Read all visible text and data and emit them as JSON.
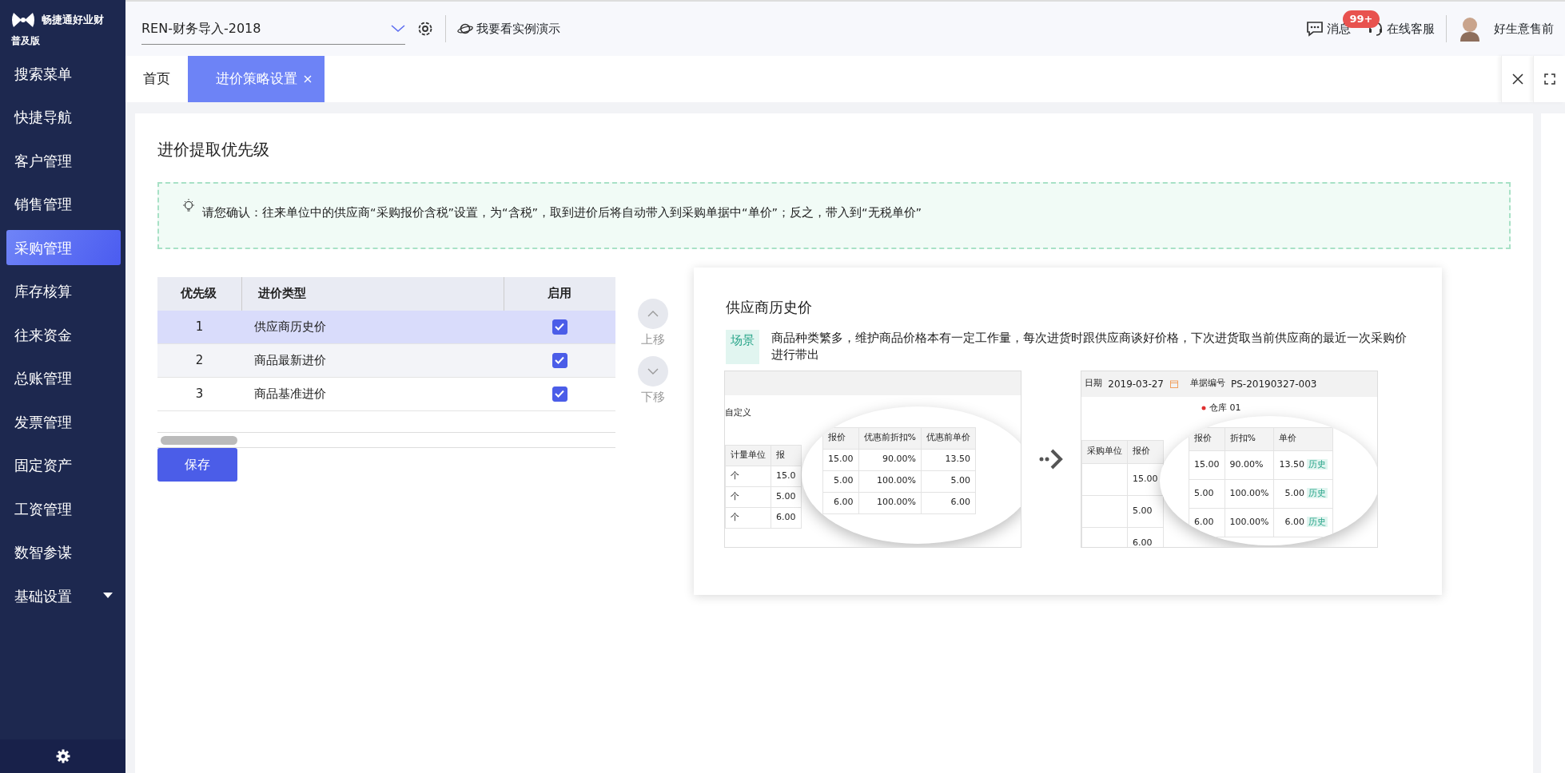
{
  "sidebar": {
    "brand": "畅捷通好业财",
    "edition": "普及版",
    "items": [
      {
        "label": "搜索菜单",
        "selected": false,
        "has_submenu": false
      },
      {
        "label": "快捷导航",
        "selected": false,
        "has_submenu": false
      },
      {
        "label": "客户管理",
        "selected": false,
        "has_submenu": false
      },
      {
        "label": "销售管理",
        "selected": false,
        "has_submenu": false
      },
      {
        "label": "采购管理",
        "selected": true,
        "has_submenu": false
      },
      {
        "label": "库存核算",
        "selected": false,
        "has_submenu": false
      },
      {
        "label": "往来资金",
        "selected": false,
        "has_submenu": false
      },
      {
        "label": "总账管理",
        "selected": false,
        "has_submenu": false
      },
      {
        "label": "发票管理",
        "selected": false,
        "has_submenu": false
      },
      {
        "label": "固定资产",
        "selected": false,
        "has_submenu": false
      },
      {
        "label": "工资管理",
        "selected": false,
        "has_submenu": false
      },
      {
        "label": "数智参谋",
        "selected": false,
        "has_submenu": false
      },
      {
        "label": "基础设置",
        "selected": false,
        "has_submenu": true
      }
    ]
  },
  "topbar": {
    "account": "REN-财务导入-2018",
    "demo_link": "我要看实例演示",
    "messages": {
      "label": "消息",
      "badge": "99+"
    },
    "support": "在线客服",
    "user": "好生意售前"
  },
  "tabs": [
    {
      "label": "首页",
      "selected": false,
      "closable": false
    },
    {
      "label": "进价策略设置",
      "selected": true,
      "closable": true
    }
  ],
  "page": {
    "title": "进价提取优先级",
    "notice": "请您确认：往来单位中的供应商“采购报价含税”设置，为“含税”，取到进价后将自动带入到采购单据中“单价”；反之，带入到“无税单价”"
  },
  "priority_table": {
    "columns": [
      "优先级",
      "进价类型",
      "启用"
    ],
    "rows": [
      {
        "priority": "1",
        "type": "供应商历史价",
        "enabled": true,
        "selected": true
      },
      {
        "priority": "2",
        "type": "商品最新进价",
        "enabled": true,
        "selected": false
      },
      {
        "priority": "3",
        "type": "商品基准进价",
        "enabled": true,
        "selected": false
      }
    ]
  },
  "move_buttons": [
    "上移",
    "下移"
  ],
  "save_button": "保存",
  "detail": {
    "title": "供应商历史价",
    "tag": "场景",
    "description": "商品种类繁多，维护商品价格本有一定工作量，每次进货时跟供应商谈好价格，下次进货取当前供应商的最近一次采购价进行带出",
    "before": {
      "label": "自定义",
      "columns": [
        "计量单位",
        "报"
      ],
      "rows": [
        [
          "个",
          "15.0"
        ],
        [
          "个",
          "5.00"
        ],
        [
          "个",
          "6.00"
        ]
      ],
      "zoom_columns": [
        "报价",
        "优惠前折扣%",
        "优惠前单价"
      ],
      "zoom_rows": [
        [
          "15.00",
          "90.00%",
          "13.50"
        ],
        [
          "5.00",
          "100.00%",
          "5.00"
        ],
        [
          "6.00",
          "100.00%",
          "6.00"
        ]
      ]
    },
    "after": {
      "fields": [
        {
          "label": "日期",
          "value": "2019-03-27",
          "kind": "date"
        },
        {
          "label": "单据编号",
          "value": "PS-20190327-003",
          "kind": "text"
        }
      ],
      "warehouse": {
        "label": "仓库",
        "value": "01"
      },
      "columns": [
        "采购单位",
        "报价"
      ],
      "values": [
        "15.00",
        "5.00",
        "6.00"
      ],
      "zoom_columns": [
        "报价",
        "折扣%",
        "单价"
      ],
      "zoom_rows": [
        [
          "15.00",
          "90.00%",
          "13.50",
          "历史"
        ],
        [
          "5.00",
          "100.00%",
          "5.00",
          "历史"
        ],
        [
          "6.00",
          "100.00%",
          "6.00",
          "历史"
        ]
      ]
    }
  }
}
